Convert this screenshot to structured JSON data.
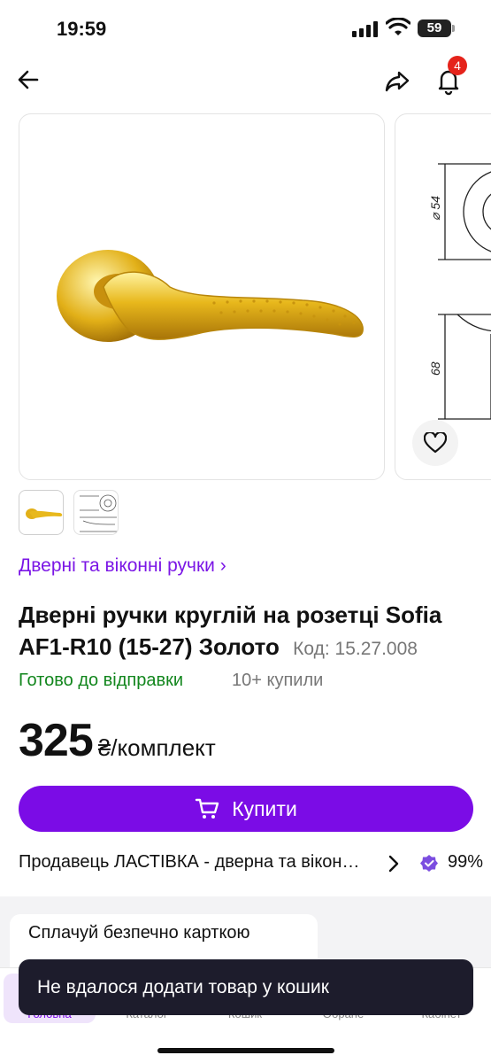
{
  "status_bar": {
    "time": "19:59",
    "battery": "59"
  },
  "nav": {
    "notifications_count": "4"
  },
  "breadcrumb": {
    "label": "Дверні та віконні ручки",
    "chevron": "›"
  },
  "product": {
    "title": "Дверні ручки круглій на розетці Sofia AF1-R10 (15-27) Золото",
    "code": "Код: 15.27.008",
    "availability": "Готово до відправки",
    "bought": "10+ купили",
    "price": "325",
    "price_unit": "₴/комплект",
    "drawing_dims": {
      "diameter": "⌀ 54",
      "height": "68"
    }
  },
  "buy_button": {
    "label": "Купити"
  },
  "seller": {
    "name": "Продавець ЛАСТІВКА - дверна та віконна фурнітура",
    "rating": "99%"
  },
  "payment": {
    "title": "Сплачуй безпечно карткою"
  },
  "bottom_nav": {
    "items": [
      {
        "label": "Головна",
        "icon": "home-icon"
      },
      {
        "label": "Каталог",
        "icon": "catalog-icon"
      },
      {
        "label": "Кошик",
        "icon": "cart-icon"
      },
      {
        "label": "Обране",
        "icon": "heart-icon"
      },
      {
        "label": "Кабінет",
        "icon": "user-icon"
      }
    ]
  },
  "toast": {
    "message": "Не вдалося додати товар у кошик"
  },
  "colors": {
    "accent": "#7b0ce6",
    "availability": "#12861d",
    "badge": "#e5231b",
    "toast_bg": "#1d1c2c"
  }
}
